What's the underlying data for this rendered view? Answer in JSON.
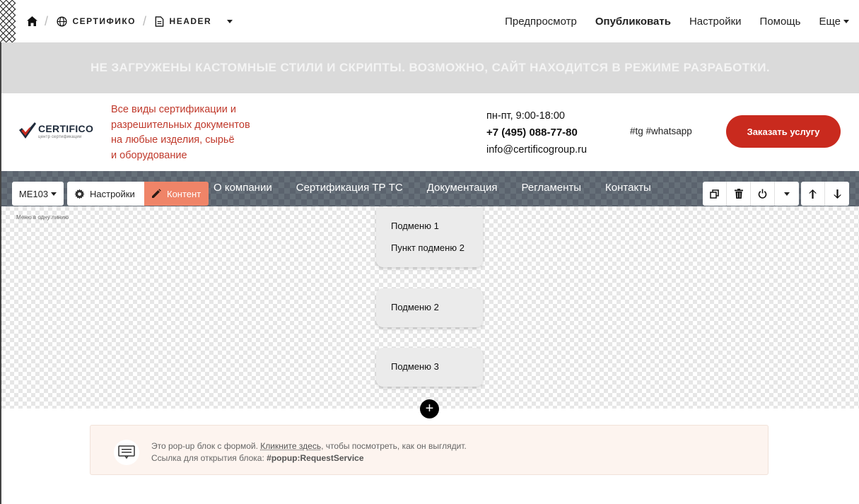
{
  "topbar": {
    "breadcrumb": {
      "site": "СЕРТИФИКО",
      "page": "HEADER"
    },
    "nav": {
      "preview": "Предпросмотр",
      "publish": "Опубликовать",
      "settings": "Настройки",
      "help": "Помощь",
      "more": "Еще"
    }
  },
  "banner": {
    "text": "НЕ ЗАГРУЖЕНЫ КАСТОМНЫЕ СТИЛИ И СКРИПТЫ. ВОЗМОЖНО, САЙТ НАХОДИТСЯ В РЕЖИМЕ РАЗРАБОТКИ."
  },
  "header": {
    "logo_name": "CERTIFICO",
    "logo_sub": "центр сертификации",
    "tagline": [
      "Все виды сертификации и",
      "разрешительных документов",
      "на любые изделия, сырьё",
      "и оборудование"
    ],
    "hours": "пн-пт, 9:00-18:00",
    "phone": "+7 (495) 088-77-80",
    "email": "info@certificogroup.ru",
    "socials": "#tg #whatsapp",
    "cta": "Заказать услугу",
    "brand_color": "#c92a1e"
  },
  "editor": {
    "block_code": "ME103",
    "settings_label": "Настройки",
    "content_label": "Контент",
    "block_hint": "Меню в одну линию",
    "accent_color": "#ef8468"
  },
  "menu": {
    "items": [
      "О компании",
      "Сертификация ТР ТС",
      "Документация",
      "Регламенты",
      "Контакты"
    ]
  },
  "submenus": [
    {
      "items": [
        "Подменю 1",
        "Пункт подменю 2"
      ]
    },
    {
      "items": [
        "Подменю 2"
      ]
    },
    {
      "items": [
        "Подменю 3"
      ]
    }
  ],
  "add_button": "+",
  "notice": {
    "line1_prefix": "Это pop-up блок с формой.",
    "line1_link": "Кликните здесь",
    "line1_suffix": ", чтобы посмотреть, как он выглядит.",
    "line2_prefix": "Ссылка для открытия блока:",
    "line2_code": "#popup:RequestService"
  },
  "icons": [
    "home-icon",
    "globe-icon",
    "page-icon",
    "gear-icon",
    "pencil-icon",
    "duplicate-icon",
    "trash-icon",
    "power-icon",
    "arrow-up-icon",
    "arrow-down-icon",
    "popup-icon"
  ]
}
